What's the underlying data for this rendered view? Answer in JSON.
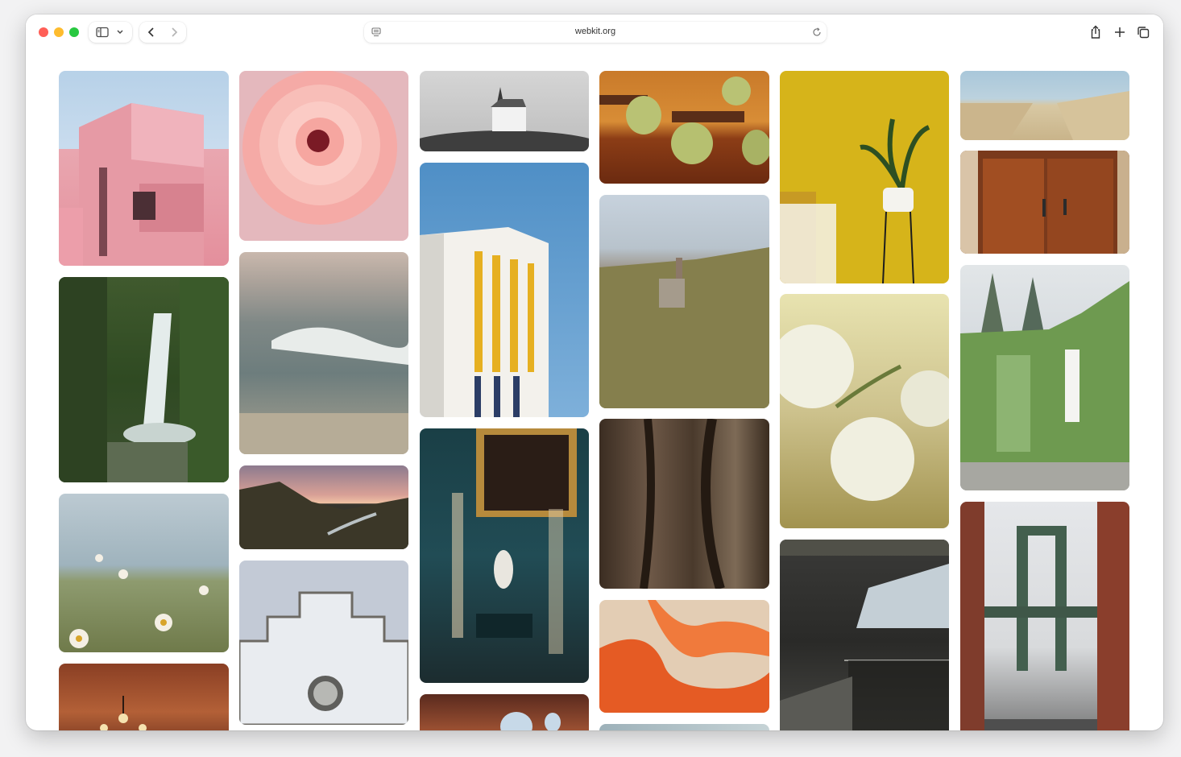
{
  "browser": {
    "url": "webkit.org"
  },
  "icons": {
    "sidebar": "sidebar-toggle-icon",
    "chevron": "chevron-down-icon",
    "back": "back-chevron-icon",
    "forward": "forward-chevron-icon",
    "page": "page-menu-icon",
    "reload": "reload-icon",
    "share": "share-icon",
    "new_tab": "plus-icon",
    "tabs": "tab-overview-icon"
  },
  "colors": {
    "close": "#ff5f57",
    "minimize": "#febc2e",
    "maximize": "#28c840"
  }
}
